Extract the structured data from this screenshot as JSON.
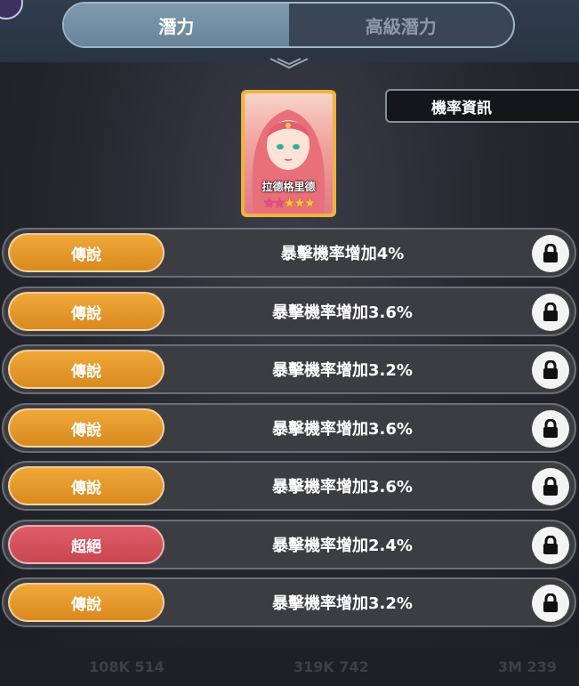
{
  "tabs": [
    {
      "label": "潛力",
      "active": true
    },
    {
      "label": "高級潛力",
      "active": false
    }
  ],
  "character": {
    "name": "拉德格里德",
    "stars": 5,
    "star_colors": [
      "#e84d8a",
      "#e84d8a",
      "#f8c23a",
      "#f8c23a",
      "#f8c23a"
    ]
  },
  "info_button": {
    "label": "機率資訊"
  },
  "potentials": [
    {
      "grade": "傳說",
      "text": "暴擊機率增加4%",
      "locked": true
    },
    {
      "grade": "傳說",
      "text": "暴擊機率增加3.6%",
      "locked": true
    },
    {
      "grade": "傳說",
      "text": "暴擊機率增加3.2%",
      "locked": true
    },
    {
      "grade": "傳說",
      "text": "暴擊機率增加3.6%",
      "locked": true
    },
    {
      "grade": "傳說",
      "text": "暴擊機率增加3.6%",
      "locked": true
    },
    {
      "grade": "超絕",
      "text": "暴擊機率增加2.4%",
      "locked": true
    },
    {
      "grade": "傳說",
      "text": "暴擊機率增加3.2%",
      "locked": true
    }
  ],
  "bottom_stats": [
    "108K 514",
    "319K 742",
    "3M 239"
  ],
  "colors": {
    "legend": "#e39a2b",
    "ultra": "#d2525c",
    "active_tab": "#7590a6"
  }
}
